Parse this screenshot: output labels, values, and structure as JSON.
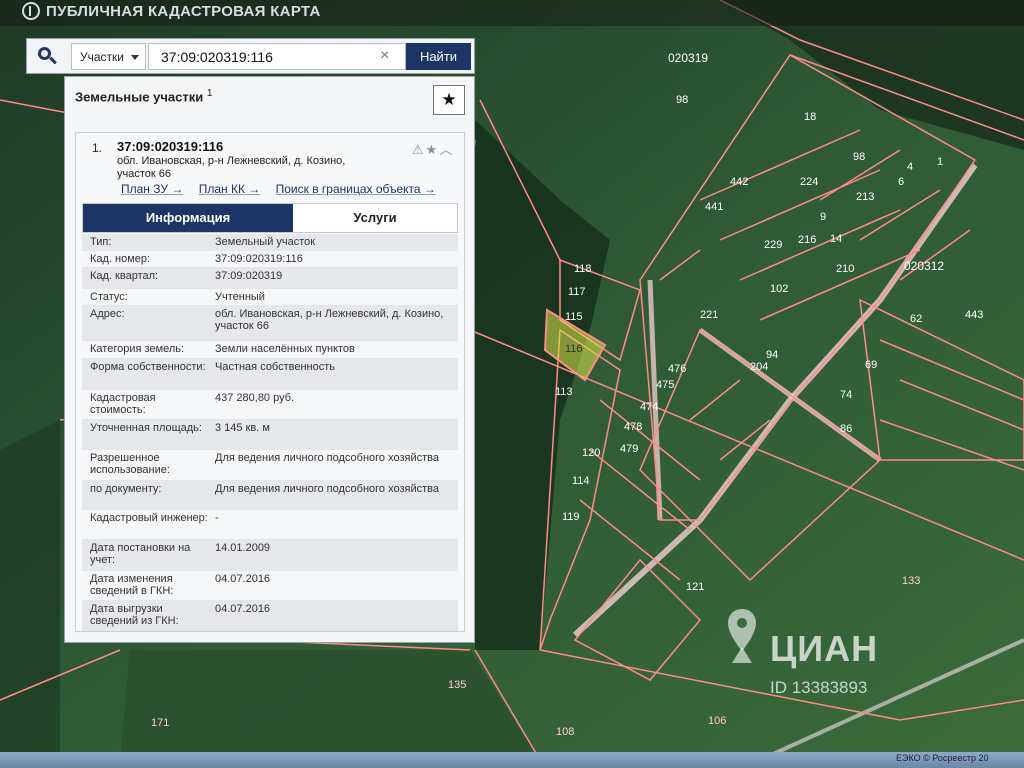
{
  "header": {
    "title": "ПУБЛИЧНАЯ КАДАСТРОВАЯ КАРТА"
  },
  "search": {
    "type_label": "Участки",
    "query": "37:09:020319:116",
    "clear_symbol": "×",
    "button_label": "Найти"
  },
  "panel": {
    "title": "Земельные участки",
    "count": "1",
    "favorite_symbol": "★"
  },
  "result": {
    "index": "1.",
    "cad_number": "37:09:020319:116",
    "address": "обл. Ивановская, р-н Лежневский, д. Козино, участок 66",
    "links": [
      "План ЗУ →",
      "План КК →",
      "Поиск в границах объекта →"
    ],
    "icons": [
      "warning-icon",
      "star-icon",
      "chevron-up-icon"
    ]
  },
  "tabs": {
    "info": "Информация",
    "services": "Услуги"
  },
  "details": [
    {
      "label": "Тип:",
      "value": "Земельный участок"
    },
    {
      "label": "Кад. номер:",
      "value": "37:09:020319:116"
    },
    {
      "label": "Кад. квартал:",
      "value": "37:09:020319"
    },
    {
      "label": "Статус:",
      "value": "Учтенный"
    },
    {
      "label": "Адрес:",
      "value": "обл. Ивановская, р-н Лежневский, д. Козино, участок 66"
    },
    {
      "label": "Категория земель:",
      "value": "Земли населённых пунктов"
    },
    {
      "label": "Форма собственности:",
      "value": "Частная собственность"
    },
    {
      "label": "Кадастровая стоимость:",
      "value": "437 280,80 руб."
    },
    {
      "label": "Уточненная площадь:",
      "value": "3 145 кв. м"
    },
    {
      "label": "Разрешенное использование:",
      "value": "Для ведения личного подсобного хозяйства"
    },
    {
      "label": "по документу:",
      "value": "Для ведения личного подсобного хозяйства"
    },
    {
      "label": "Кадастровый инженер:",
      "value": "-"
    },
    {
      "label": "Дата постановки на учет:",
      "value": "14.01.2009"
    },
    {
      "label": "Дата изменения сведений в ГКН:",
      "value": "04.07.2016"
    },
    {
      "label": "Дата выгрузки сведений из ГКН:",
      "value": "04.07.2016"
    }
  ],
  "map": {
    "quarter_labels": [
      "020319",
      "020312"
    ],
    "parcel_labels": [
      "98",
      "118",
      "117",
      "116",
      "115",
      "113",
      "476",
      "475",
      "474",
      "478",
      "479",
      "120",
      "114",
      "119",
      "121",
      "133",
      "135",
      "171",
      "108",
      "106",
      "221",
      "204",
      "229",
      "210",
      "213",
      "442",
      "441",
      "443",
      "224",
      "216",
      "102",
      "69",
      "62",
      "74",
      "18",
      "98",
      "14",
      "1",
      "4",
      "94",
      "86",
      "9",
      "6"
    ],
    "colors": {
      "parcel_outline": "#ff8a8a",
      "selected_parcel": "#d8e84a"
    }
  },
  "watermark": {
    "brand": "ЦИАН",
    "id": "ID 13383893"
  },
  "footer": {
    "copyright": "ЕЭКО © Росреестр 20"
  }
}
